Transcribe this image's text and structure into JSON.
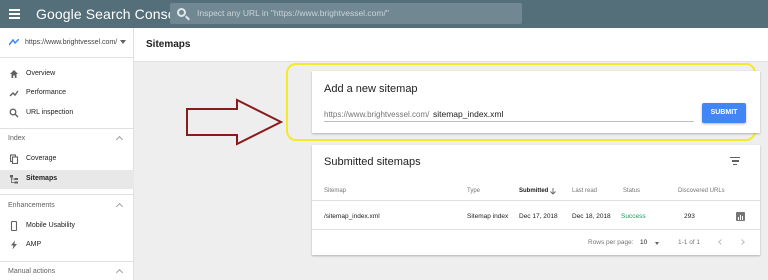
{
  "topbar": {
    "brand": "Google Search Console",
    "search_placeholder": "Inspect any URL in \"https://www.brightvessel.com/\""
  },
  "sidebar": {
    "property": "https://www.brightvessel.com/",
    "items": [
      {
        "label": "Overview",
        "icon": "home-icon"
      },
      {
        "label": "Performance",
        "icon": "trending-icon"
      },
      {
        "label": "URL inspection",
        "icon": "search-icon"
      }
    ],
    "sections": [
      {
        "label": "Index",
        "items": [
          {
            "label": "Coverage",
            "icon": "copy-icon"
          },
          {
            "label": "Sitemaps",
            "icon": "sitemap-icon",
            "active": true
          }
        ]
      },
      {
        "label": "Enhancements",
        "items": [
          {
            "label": "Mobile Usability",
            "icon": "phone-icon"
          },
          {
            "label": "AMP",
            "icon": "bolt-icon"
          }
        ]
      },
      {
        "label": "Manual actions",
        "items": []
      }
    ]
  },
  "header": {
    "title": "Sitemaps"
  },
  "add_sitemap": {
    "title": "Add a new sitemap",
    "prefix": "https://www.brightvessel.com/",
    "input_value": "sitemap_index.xml",
    "submit_label": "SUBMIT"
  },
  "submitted": {
    "title": "Submitted sitemaps",
    "columns": [
      "Sitemap",
      "Type",
      "Submitted",
      "Last read",
      "Status",
      "Discovered URLs"
    ],
    "rows": [
      {
        "sitemap": "/sitemap_index.xml",
        "type": "Sitemap index",
        "submitted": "Dec 17, 2018",
        "last_read": "Dec 18, 2018",
        "status": "Success",
        "urls": "293"
      }
    ],
    "pagination": {
      "rows_per_page_label": "Rows per page:",
      "rows_per_page": "10",
      "range": "1-1 of 1"
    }
  },
  "colors": {
    "topbar": "#546e7a",
    "accent": "#4285f4",
    "success": "#0f9d58",
    "highlight": "#f3ea2a",
    "arrow": "#8b1a1a"
  }
}
